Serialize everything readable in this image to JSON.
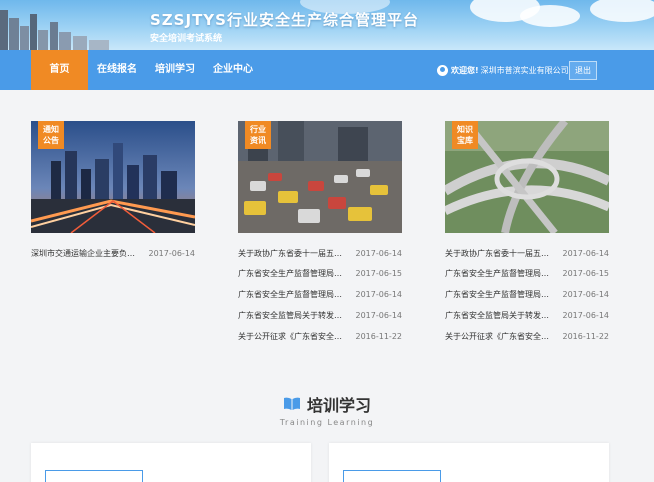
{
  "header": {
    "title": "SZSJTYS行业安全生产综合管理平台",
    "subtitle": "安全培训考试系统"
  },
  "nav": {
    "items": [
      {
        "label": "首页",
        "active": true
      },
      {
        "label": "在线报名",
        "active": false
      },
      {
        "label": "培训学习",
        "active": false
      },
      {
        "label": "企业中心",
        "active": false
      }
    ],
    "welcome": "欢迎您!",
    "company": "深圳市普滨实业有限公司",
    "logout": "退出"
  },
  "columns": [
    {
      "tag_line1": "通知",
      "tag_line2": "公告",
      "items": [
        {
          "title": "深圳市交通运输企业主要负责人安全培训通知",
          "date": "2017-06-14"
        }
      ]
    },
    {
      "tag_line1": "行业",
      "tag_line2": "资讯",
      "items": [
        {
          "title": "关于政协广东省委十一届五次会议提案的答复",
          "date": "2017-06-14"
        },
        {
          "title": "广东省安全生产监督管理局关于印发通知",
          "date": "2017-06-15"
        },
        {
          "title": "广东省安全生产监督管理局关于开展检查",
          "date": "2017-06-14"
        },
        {
          "title": "广东省安全监管局关于转发国家安全监管总局",
          "date": "2017-06-14"
        },
        {
          "title": "关于公开征求《广东省安全生产条例》意见",
          "date": "2016-11-22"
        }
      ]
    },
    {
      "tag_line1": "知识",
      "tag_line2": "宝库",
      "items": [
        {
          "title": "关于政协广东省委十一届五次会议提案的答复",
          "date": "2017-06-14"
        },
        {
          "title": "广东省安全生产监督管理局关于印发通知",
          "date": "2017-06-15"
        },
        {
          "title": "广东省安全生产监督管理局关于开展检查",
          "date": "2017-06-14"
        },
        {
          "title": "广东省安全监管局关于转发国家安全监管总局",
          "date": "2017-06-14"
        },
        {
          "title": "关于公开征求《广东省安全生产条例》意见",
          "date": "2016-11-22"
        }
      ]
    }
  ],
  "training": {
    "title": "培训学习",
    "subtitle": "Training Learning"
  },
  "colors": {
    "nav_blue": "#4a9be8",
    "accent_orange": "#f08a24"
  }
}
